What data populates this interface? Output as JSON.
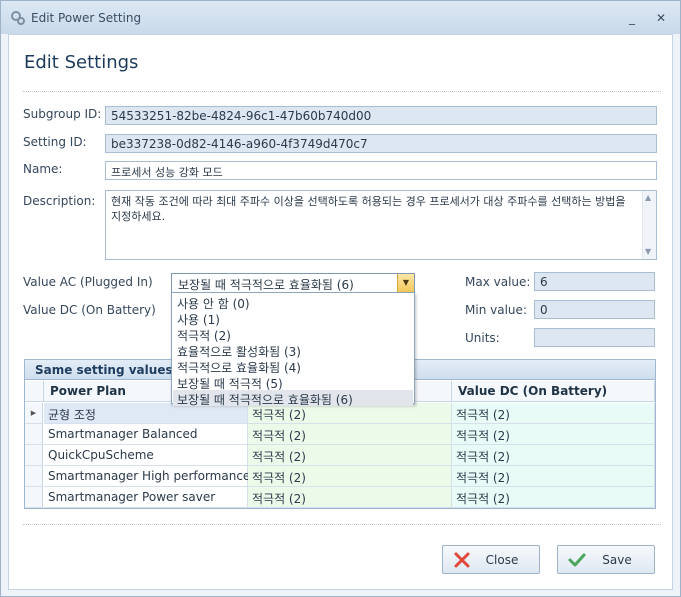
{
  "window": {
    "title": "Edit Power Setting",
    "minimize_glyph": "_",
    "close_glyph": "✕"
  },
  "heading": "Edit Settings",
  "fields": {
    "subgroup_id": {
      "label": "Subgroup ID:",
      "value": "54533251-82be-4824-96c1-47b60b740d00"
    },
    "setting_id": {
      "label": "Setting ID:",
      "value": "be337238-0d82-4146-a960-4f3749d470c7"
    },
    "name": {
      "label": "Name:",
      "value": "프로세서 성능 강화 모드"
    },
    "description": {
      "label": "Description:",
      "value": "현재 작동 조건에 따라 최대 주파수 이상을 선택하도록 허용되는 경우 프로세서가 대상 주파수를 선택하는 방법을 지정하세요."
    },
    "value_ac": {
      "label": "Value AC (Plugged In)",
      "value": "보장될 때 적극적으로 효율화됨 (6)"
    },
    "value_dc": {
      "label": "Value DC (On Battery)"
    },
    "max_value": {
      "label": "Max value:",
      "value": "6"
    },
    "min_value": {
      "label": "Min value:",
      "value": "0"
    },
    "units": {
      "label": "Units:",
      "value": ""
    }
  },
  "dropdown_options": [
    "사용 안 함 (0)",
    "사용 (1)",
    "적극적 (2)",
    "효율적으로 활성화됨 (3)",
    "적극적으로 효율화됨 (4)",
    "보장될 때 적극적 (5)",
    "보장될 때 적극적으로 효율화됨 (6)"
  ],
  "dropdown_selected_index": 6,
  "grid": {
    "caption": "Same setting values for",
    "columns": [
      "Power Plan",
      "",
      "Value DC (On Battery)"
    ],
    "rows": [
      {
        "plan": "균형 조정",
        "ac": "적극적 (2)",
        "dc": "적극적 (2)"
      },
      {
        "plan": "Smartmanager Balanced",
        "ac": "적극적 (2)",
        "dc": "적극적 (2)"
      },
      {
        "plan": "QuickCpuScheme",
        "ac": "적극적 (2)",
        "dc": "적극적 (2)"
      },
      {
        "plan": "Smartmanager High performance",
        "ac": "적극적 (2)",
        "dc": "적극적 (2)"
      },
      {
        "plan": "Smartmanager Power saver",
        "ac": "적극적 (2)",
        "dc": "적극적 (2)"
      }
    ]
  },
  "buttons": {
    "close": "Close",
    "save": "Save"
  },
  "colors": {
    "accent_button": "#f4c85a",
    "close_icon": "#e0483a",
    "save_icon": "#4aa65a"
  }
}
